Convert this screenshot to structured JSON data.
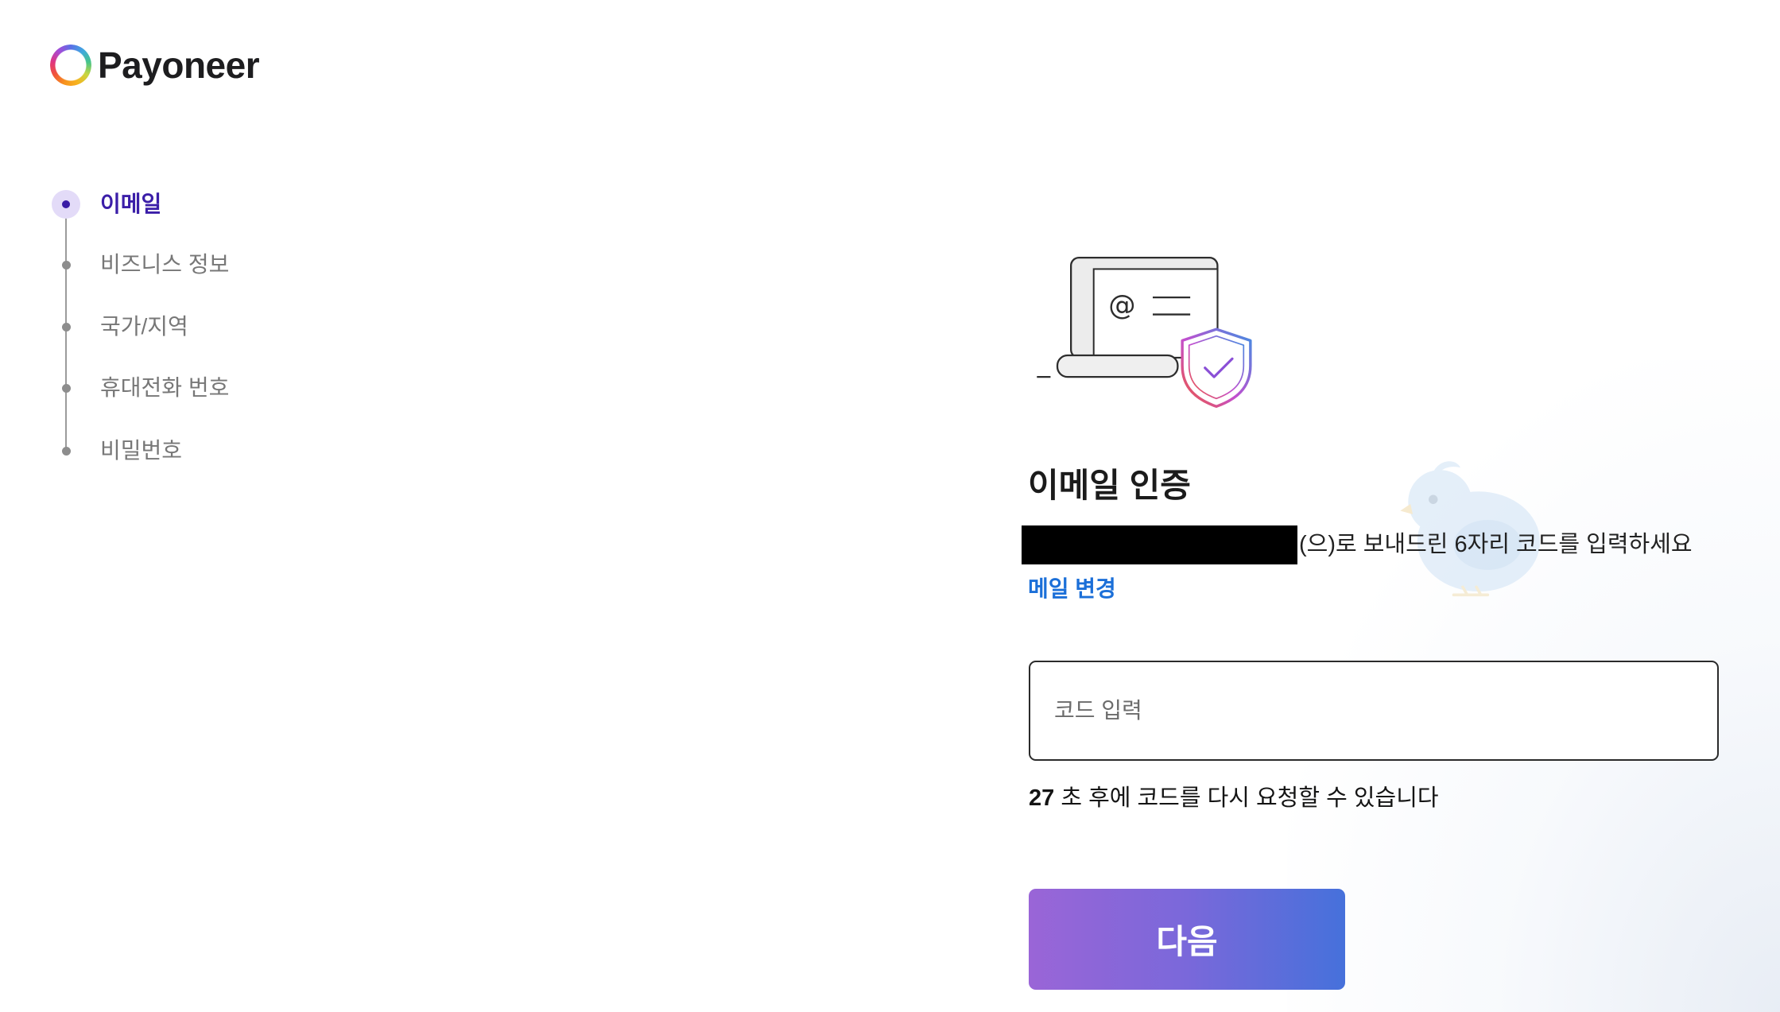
{
  "brand": {
    "name": "Payoneer",
    "logo_icon": "payoneer-ring-logo-icon"
  },
  "steps": {
    "active_index": 0,
    "items": [
      {
        "label": "이메일"
      },
      {
        "label": "비즈니스 정보"
      },
      {
        "label": "국가/지역"
      },
      {
        "label": "휴대전화 번호"
      },
      {
        "label": "비밀번호"
      }
    ]
  },
  "verification": {
    "illustration_icon": "laptop-email-shield-icon",
    "title": "이메일 인증",
    "instruction": "(으)로 보내드린 6자리 코드를 입력하세요",
    "change_email_link": "메일 변경",
    "code_input": {
      "placeholder": "코드 입력",
      "value": ""
    },
    "resend": {
      "seconds": "27",
      "text": "초 후에 코드를 다시 요청할 수 있습니다"
    },
    "next_button": "다음"
  },
  "colors": {
    "active_step": "#3b1ea8",
    "inactive_step": "#777777",
    "link": "#1b6fd8",
    "button_gradient_start": "#9a65d7",
    "button_gradient_end": "#4671db",
    "input_border": "#2b2b2b"
  }
}
